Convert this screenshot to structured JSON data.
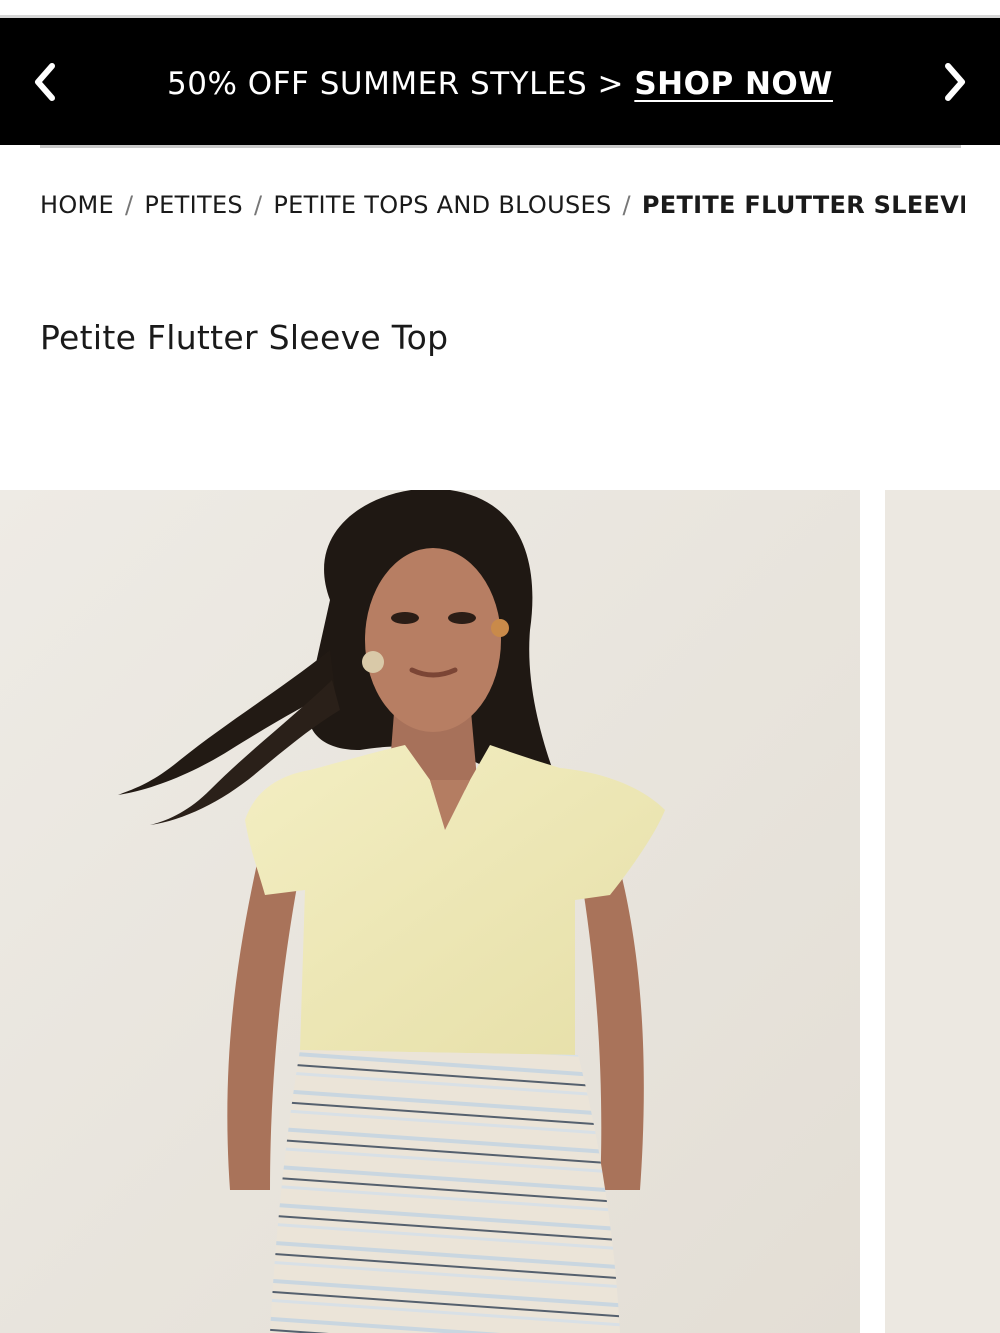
{
  "promo": {
    "text": "50% OFF SUMMER STYLES > ",
    "link": "SHOP NOW",
    "prev_icon": "chevron-left-icon",
    "next_icon": "chevron-right-icon"
  },
  "breadcrumb": {
    "items": [
      "HOME",
      "PETITES",
      "PETITE TOPS AND BLOUSES"
    ],
    "separator": "/",
    "current": "PETITE FLUTTER SLEEVE T..."
  },
  "product": {
    "title": "Petite Flutter Sleeve Top"
  },
  "colors": {
    "promo_bg": "#000000",
    "promo_text": "#ffffff",
    "photo_bg": "#eae6df",
    "top_color": "#f1ecb9"
  }
}
